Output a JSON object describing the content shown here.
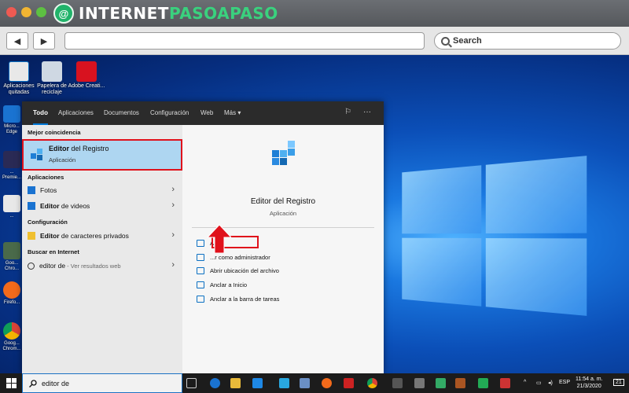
{
  "brand": {
    "logo_left": "INTERNET",
    "logo_right": "PASOAPASO",
    "logo_badge": "@"
  },
  "browser": {
    "back": "◀",
    "forward": "▶",
    "search_placeholder": "Search"
  },
  "desktop": {
    "icons": [
      {
        "label": "Aplicaciones quitadas",
        "color": "#e8e8e8"
      },
      {
        "label": "Papelera de reciclaje",
        "color": "#cfd8e3"
      },
      {
        "label": "Adobe Creati...",
        "color": "#d8121f"
      }
    ],
    "side_labels": [
      "Micro... Edge",
      "... Premie...",
      "...",
      "Goo... Chro...",
      "Firefo...",
      "Goog... Chrom..."
    ]
  },
  "search_panel": {
    "tabs": [
      "Todo",
      "Aplicaciones",
      "Documentos",
      "Configuración",
      "Web",
      "Más ▾"
    ],
    "more_icon": "···",
    "feedback_icon": "⚐",
    "best_match_heading": "Mejor coincidencia",
    "best_match": {
      "name_prefix": "Editor ",
      "name_bold": "del",
      "name_suffix": " Registro",
      "type": "Aplicación"
    },
    "apps_heading": "Aplicaciones",
    "apps": [
      {
        "label": "Fotos"
      },
      {
        "label_bold": "Editor",
        "label_rest": " de videos"
      }
    ],
    "config_heading": "Configuración",
    "config_items": [
      {
        "label_bold": "Editor",
        "label_rest": " de caracteres privados"
      }
    ],
    "internet_heading": "Buscar en Internet",
    "internet_items": [
      {
        "query": "editor de",
        "suffix": " - Ver resultados web"
      }
    ],
    "preview": {
      "title": "Editor del Registro",
      "subtitle": "Aplicación",
      "actions": [
        "Abrir",
        "...r como administrador",
        "Abrir ubicación del archivo",
        "Anclar a Inicio",
        "Anclar a la barra de tareas"
      ]
    }
  },
  "taskbar": {
    "search_text": "editor de",
    "tray": {
      "lang": "ESP",
      "time": "11:54 a. m.",
      "date": "21/3/2020",
      "notifications": "21"
    }
  },
  "colors": {
    "highlight_red": "#e0111b",
    "selection_blue": "#aed6f1",
    "accent": "#0078d7"
  }
}
